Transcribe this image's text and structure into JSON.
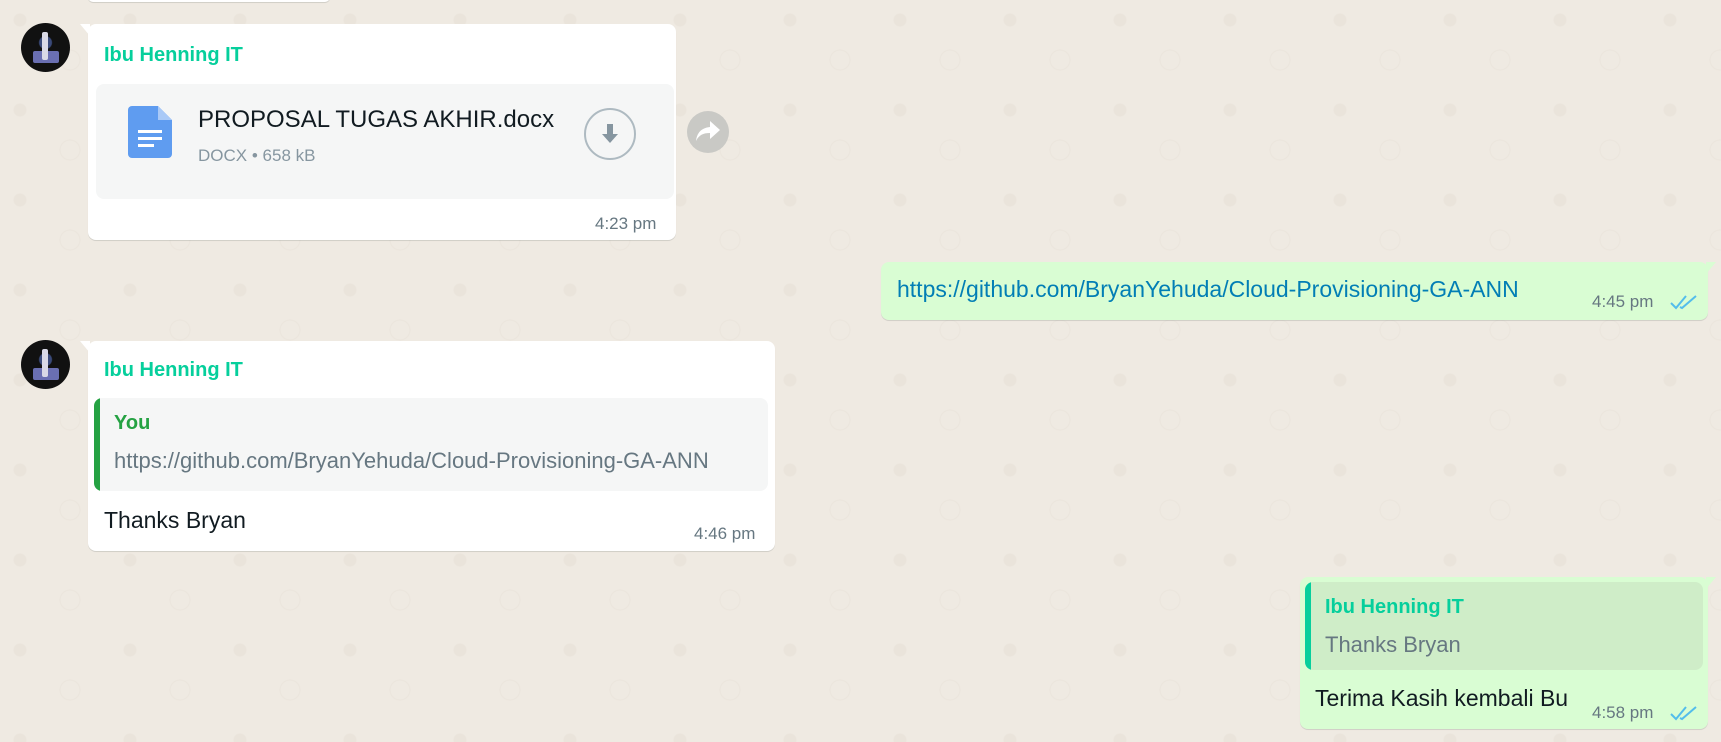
{
  "colors": {
    "chat_background": "#efeae2",
    "incoming_bubble": "#ffffff",
    "outgoing_bubble": "#d9fdd3",
    "sender_name": "#06cf9c",
    "link": "#027eb5",
    "read_ticks": "#53bdeb",
    "quote_bar_you": "#25a243",
    "quote_bar_contact": "#06cf9c"
  },
  "messages": [
    {
      "direction": "incoming",
      "sender": "Ibu Henning IT",
      "document": {
        "icon": "document-icon",
        "name": "PROPOSAL TUGAS AKHIR.docx",
        "type": "DOCX",
        "separator": "•",
        "size": "658 kB",
        "download_icon": "download-icon"
      },
      "forward_icon": "forward-icon",
      "time": "4:23 pm"
    },
    {
      "direction": "outgoing",
      "text": "https://github.com/BryanYehuda/Cloud-Provisioning-GA-ANN",
      "time": "4:45 pm",
      "status_icon": "double-check-read-icon"
    },
    {
      "direction": "incoming",
      "sender": "Ibu Henning IT",
      "quote": {
        "author": "You",
        "text": "https://github.com/BryanYehuda/Cloud-Provisioning-GA-ANN"
      },
      "text": "Thanks Bryan",
      "time": "4:46 pm"
    },
    {
      "direction": "outgoing",
      "quote": {
        "author": "Ibu Henning IT",
        "text": "Thanks Bryan"
      },
      "text": "Terima Kasih kembali Bu",
      "time": "4:58 pm",
      "status_icon": "double-check-read-icon"
    }
  ]
}
